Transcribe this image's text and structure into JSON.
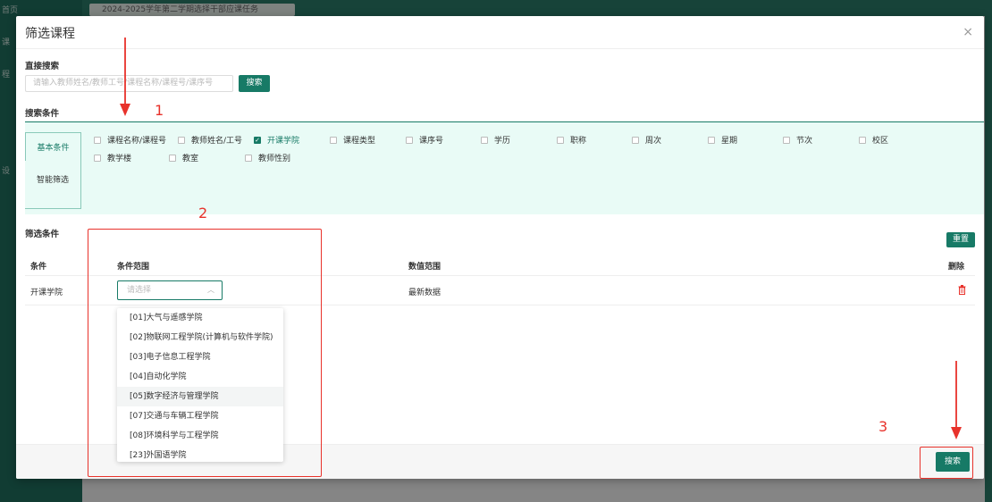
{
  "background": {
    "tab_text": "2024-2025学年第二学期选择干部应课任务",
    "side_labels": [
      "首页",
      "课",
      "程",
      "设"
    ]
  },
  "modal": {
    "title": "筛选课程",
    "close": "×"
  },
  "direct_search": {
    "heading": "直接搜索",
    "placeholder": "请输入教师姓名/教师工号/课程名称/课程号/课序号",
    "button": "搜索"
  },
  "search_conditions": {
    "heading": "搜索条件",
    "tabs": [
      "基本条件",
      "智能筛选"
    ],
    "checkbox_rows": [
      [
        {
          "label": "课程名称/课程号",
          "checked": false
        },
        {
          "label": "教师姓名/工号",
          "checked": false
        },
        {
          "label": "开课学院",
          "checked": true
        },
        {
          "label": "课程类型",
          "checked": false
        },
        {
          "label": "课序号",
          "checked": false
        },
        {
          "label": "学历",
          "checked": false
        },
        {
          "label": "职称",
          "checked": false
        },
        {
          "label": "周次",
          "checked": false
        },
        {
          "label": "星期",
          "checked": false
        },
        {
          "label": "节次",
          "checked": false
        },
        {
          "label": "校区",
          "checked": false
        }
      ],
      [
        {
          "label": "教学楼",
          "checked": false
        },
        {
          "label": "教室",
          "checked": false
        },
        {
          "label": "教师性别",
          "checked": false
        }
      ]
    ]
  },
  "filter": {
    "heading": "筛选条件",
    "reset": "重置",
    "columns": [
      "条件",
      "条件范围",
      "数值范围",
      "删除"
    ],
    "row": {
      "condition": "开课学院",
      "select_placeholder": "请选择",
      "value_range": "最新数据"
    },
    "options": [
      "[01]大气与遥感学院",
      "[02]物联网工程学院(计算机与软件学院)",
      "[03]电子信息工程学院",
      "[04]自动化学院",
      "[05]数字经济与管理学院",
      "[07]交通与车辆工程学院",
      "[08]环境科学与工程学院",
      "[23]外国语学院"
    ],
    "hovered_option_index": 4
  },
  "footer": {
    "search_button": "搜索"
  },
  "annotations": {
    "labels": [
      "1",
      "2",
      "3"
    ],
    "color": "#e8322b"
  },
  "colors": {
    "primary": "#177a66",
    "panel_bg": "#e9fbf6",
    "danger": "#e8322b"
  }
}
